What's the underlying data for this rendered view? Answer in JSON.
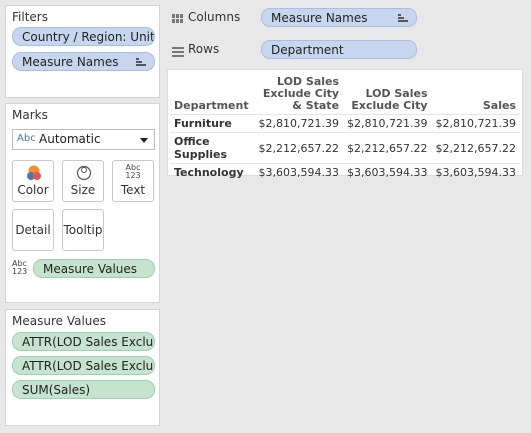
{
  "filters": {
    "title": "Filters",
    "items": [
      "Country / Region: Unit..",
      "Measure Names"
    ]
  },
  "marks": {
    "title": "Marks",
    "type_icon": "Abc",
    "type_value": "Automatic",
    "buttons": {
      "color": "Color",
      "size": "Size",
      "text": "Text",
      "text_icon_top": "Abc",
      "text_icon_bottom": "123",
      "detail": "Detail",
      "tooltip": "Tooltip"
    },
    "field_icon_top": "Abc",
    "field_icon_bottom": "123",
    "field": "Measure Values"
  },
  "measure_values": {
    "title": "Measure Values",
    "items": [
      "ATTR(LOD Sales Exclud..",
      "ATTR(LOD Sales Exclud..",
      "SUM(Sales)"
    ]
  },
  "columns_shelf": {
    "label": "Columns",
    "pill": "Measure Names"
  },
  "rows_shelf": {
    "label": "Rows",
    "pill": "Department"
  },
  "table": {
    "row_header": "Department",
    "col1": [
      "LOD Sales",
      "Exclude City",
      "& State"
    ],
    "col2": [
      "LOD Sales",
      "Exclude City"
    ],
    "col3": "Sales",
    "rows": [
      {
        "dept": "Furniture",
        "v1": "$2,810,721.39",
        "v2": "$2,810,721.39",
        "v3": "$2,810,721.39"
      },
      {
        "dept": "Office Supplies",
        "v1": "$2,212,657.22",
        "v2": "$2,212,657.22",
        "v3": "$2,212,657.22"
      },
      {
        "dept": "Technology",
        "v1": "$3,603,594.33",
        "v2": "$3,603,594.33",
        "v3": "$3,603,594.33"
      }
    ]
  },
  "colors": {
    "dimension_pill": "#c6d6ee",
    "measure_pill": "#c5e3cf",
    "color_icon_orange": "#f28e2b",
    "color_icon_blue": "#4e79a7"
  }
}
